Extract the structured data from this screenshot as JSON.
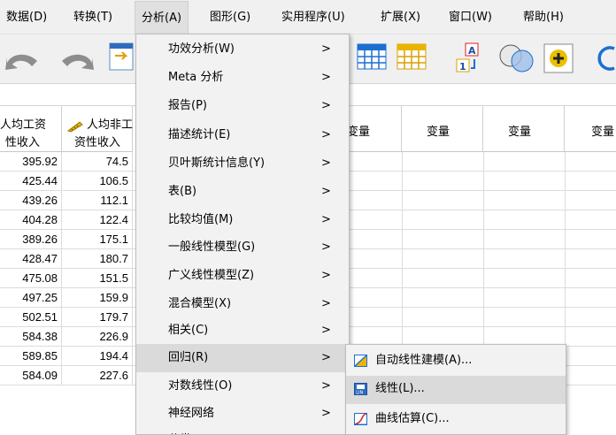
{
  "menubar": {
    "items": [
      "数据(D)",
      "转换(T)",
      "分析(A)",
      "图形(G)",
      "实用程序(U)",
      "扩展(X)",
      "窗口(W)",
      "帮助(H)"
    ],
    "active": "分析(A)"
  },
  "columns": {
    "col1": [
      "人均工资",
      "性收入"
    ],
    "col2": [
      "人均非工",
      "资性收入"
    ],
    "var_label": "变量"
  },
  "table": {
    "col1": [
      "395.92",
      "425.44",
      "439.26",
      "404.28",
      "389.26",
      "428.47",
      "475.08",
      "497.25",
      "502.51",
      "584.38",
      "589.85",
      "584.09"
    ],
    "col2": [
      "74.5",
      "106.5",
      "112.1",
      "122.4",
      "175.1",
      "180.7",
      "151.5",
      "159.9",
      "179.7",
      "226.9",
      "194.4",
      "227.6"
    ]
  },
  "analyze_menu": {
    "items": [
      {
        "label": "功效分析(W)",
        "arrow": ">"
      },
      {
        "label": "Meta 分析",
        "arrow": ">"
      },
      {
        "label": "报告(P)",
        "arrow": ">"
      },
      {
        "label": "描述统计(E)",
        "arrow": ">"
      },
      {
        "label": "贝叶斯统计信息(Y)",
        "arrow": ">"
      },
      {
        "label": "表(B)",
        "arrow": ">"
      },
      {
        "label": "比较均值(M)",
        "arrow": ">"
      },
      {
        "label": "一般线性模型(G)",
        "arrow": ">"
      },
      {
        "label": "广义线性模型(Z)",
        "arrow": ">"
      },
      {
        "label": "混合模型(X)",
        "arrow": ">"
      },
      {
        "label": "相关(C)",
        "arrow": ">"
      },
      {
        "label": "回归(R)",
        "arrow": ">"
      },
      {
        "label": "对数线性(O)",
        "arrow": ">"
      },
      {
        "label": "神经网络",
        "arrow": ">"
      },
      {
        "label": "分类(F)",
        "arrow": ">"
      }
    ],
    "highlighted": "回归(R)"
  },
  "regression_submenu": {
    "items": [
      {
        "label": "自动线性建模(A)...",
        "icon": "auto-linear-icon"
      },
      {
        "label": "线性(L)...",
        "icon": "linear-regression-icon"
      },
      {
        "label": "曲线估算(C)...",
        "icon": "curve-estimation-icon"
      }
    ],
    "highlighted": "线性(L)..."
  },
  "colors": {
    "menu_bg": "#f2f2f2",
    "highlight": "#dadada",
    "toolbar_bg": "#f0f0f0",
    "icon_blue": "#1c6fd1"
  }
}
